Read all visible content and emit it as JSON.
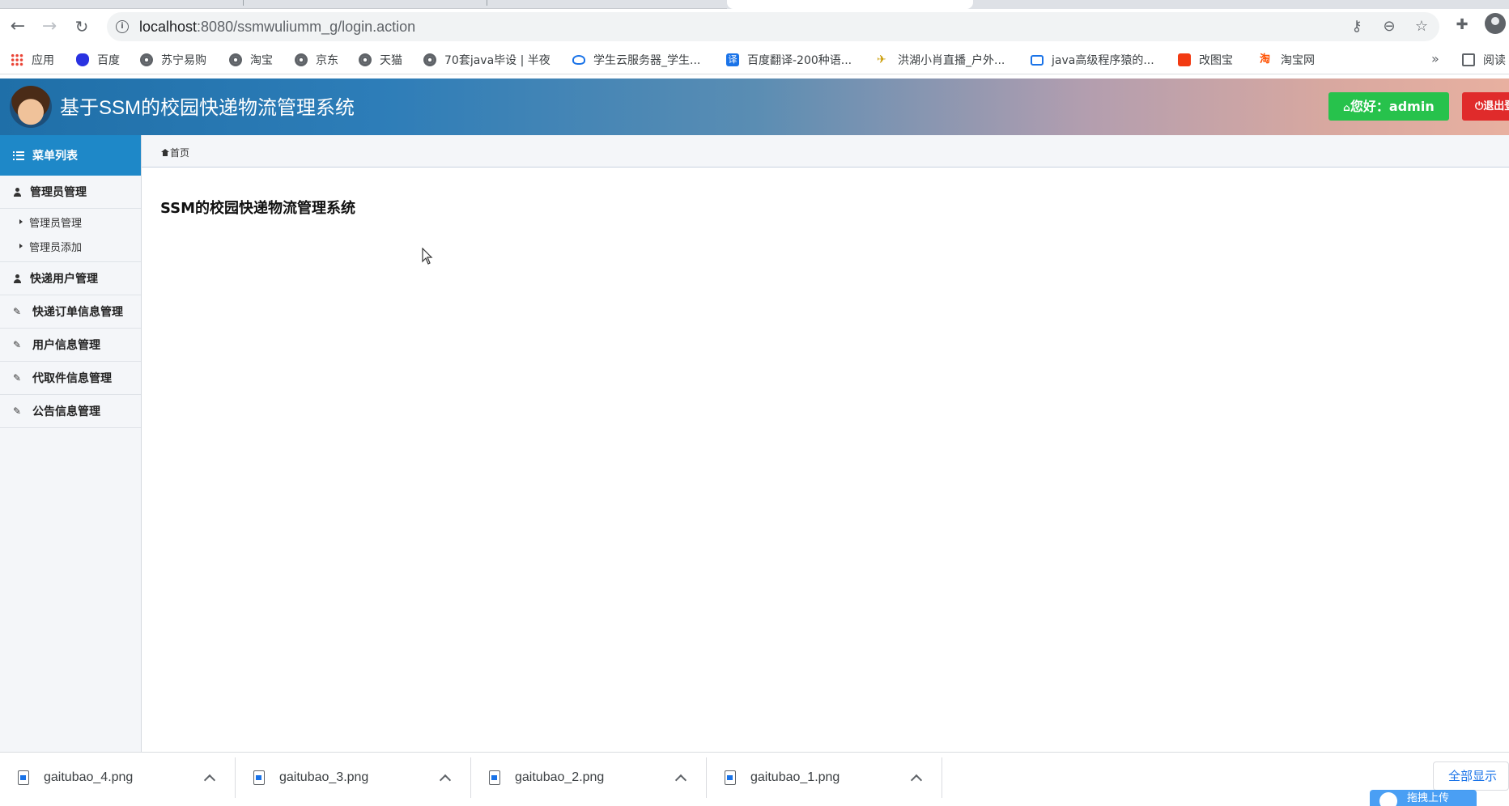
{
  "browser": {
    "url_host": "localhost",
    "url_path": ":8080/ssmwuliumm_g/login.action",
    "bookmarks": [
      {
        "label": "应用",
        "icon": "apps-icon"
      },
      {
        "label": "百度",
        "icon": "baidu-icon"
      },
      {
        "label": "苏宁易购",
        "icon": "globe-icon"
      },
      {
        "label": "淘宝",
        "icon": "globe-icon"
      },
      {
        "label": "京东",
        "icon": "globe-icon"
      },
      {
        "label": "天猫",
        "icon": "globe-icon"
      },
      {
        "label": "70套java毕设 | 半夜",
        "icon": "globe-icon"
      },
      {
        "label": "学生云服务器_学生...",
        "icon": "cloud-icon"
      },
      {
        "label": "百度翻译-200种语...",
        "icon": "fanyi-icon"
      },
      {
        "label": "洪湖小肖直播_户外...",
        "icon": "bird-icon"
      },
      {
        "label": "java高级程序猿的...",
        "icon": "bilibili-icon"
      },
      {
        "label": "改图宝",
        "icon": "gaitu-icon"
      },
      {
        "label": "淘宝网",
        "icon": "taobao-icon"
      }
    ],
    "more_bookmarks": "»",
    "reading_list": "阅读"
  },
  "header": {
    "title": "基于SSM的校园快递物流管理系统",
    "greeting": "您好：",
    "username": "admin",
    "logout_label": "退出登"
  },
  "sidebar": {
    "menu_title": "菜单列表",
    "groups": [
      {
        "title": "管理员管理",
        "icon": "user-icon",
        "items": [
          "管理员管理",
          "管理员添加"
        ]
      },
      {
        "title": "快递用户管理",
        "icon": "user-icon"
      },
      {
        "title": "快递订单信息管理",
        "icon": "edit-icon"
      },
      {
        "title": "用户信息管理",
        "icon": "edit-icon"
      },
      {
        "title": "代取件信息管理",
        "icon": "edit-icon"
      },
      {
        "title": "公告信息管理",
        "icon": "edit-icon"
      }
    ]
  },
  "main": {
    "breadcrumb": "首页",
    "heading": "SSM的校园快递物流管理系统"
  },
  "downloads": {
    "files": [
      "gaitubao_4.png",
      "gaitubao_3.png",
      "gaitubao_2.png",
      "gaitubao_1.png"
    ],
    "show_all": "全部显示",
    "drag_upload": "拖拽上传"
  },
  "colors": {
    "menu_head": "#1e88c8",
    "hello_button": "#27c24c",
    "logout_button": "#e02b2b"
  }
}
